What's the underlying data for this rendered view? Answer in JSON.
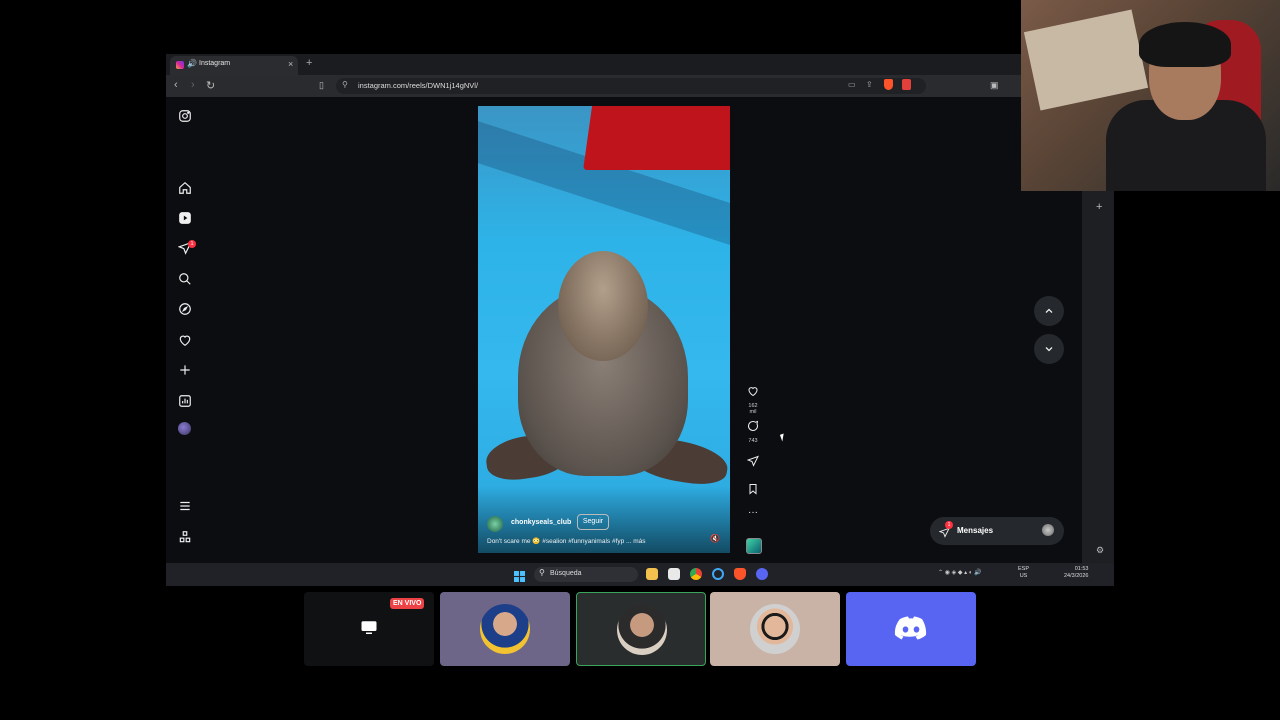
{
  "browser": {
    "tab_title": "Instagram",
    "url": "instagram.com/reels/DWN1j14gNVl/"
  },
  "sidebar": {
    "notifications_badge": "1"
  },
  "reel": {
    "username": "chonkyseals_club",
    "follow_label": "Seguir",
    "caption": "Don't scare me 😳 #sealion #funnyanimals #fyp ... más",
    "likes": "162 mil",
    "comments": "743"
  },
  "messages": {
    "label": "Mensajes",
    "badge": "1"
  },
  "taskbar": {
    "search_placeholder": "Búsqueda",
    "lang_line1": "ESP",
    "lang_line2": "US",
    "time": "01:53",
    "date": "24/3/2026"
  },
  "discord": {
    "live_label": "EN VIVO"
  },
  "colors": {
    "discord_blurple": "#5865f2",
    "live_red": "#ed4245",
    "speaking_green": "#3ba55c",
    "instagram_badge": "#ff3040"
  }
}
